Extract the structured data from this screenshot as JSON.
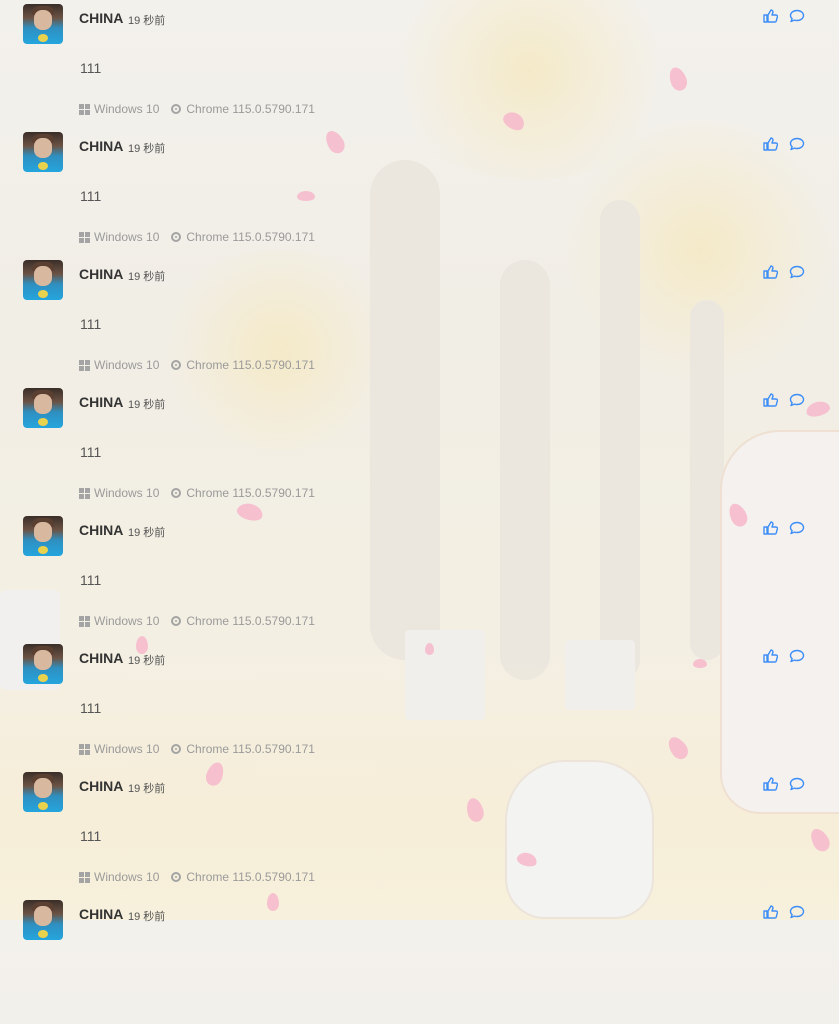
{
  "comments": [
    {
      "name": "CHINA",
      "time": "19 秒前",
      "text": "111",
      "os": "Windows 10",
      "browser": "Chrome 115.0.5790.171"
    },
    {
      "name": "CHINA",
      "time": "19 秒前",
      "text": "111",
      "os": "Windows 10",
      "browser": "Chrome 115.0.5790.171"
    },
    {
      "name": "CHINA",
      "time": "19 秒前",
      "text": "111",
      "os": "Windows 10",
      "browser": "Chrome 115.0.5790.171"
    },
    {
      "name": "CHINA",
      "time": "19 秒前",
      "text": "111",
      "os": "Windows 10",
      "browser": "Chrome 115.0.5790.171"
    },
    {
      "name": "CHINA",
      "time": "19 秒前",
      "text": "111",
      "os": "Windows 10",
      "browser": "Chrome 115.0.5790.171"
    },
    {
      "name": "CHINA",
      "time": "19 秒前",
      "text": "111",
      "os": "Windows 10",
      "browser": "Chrome 115.0.5790.171"
    },
    {
      "name": "CHINA",
      "time": "19 秒前",
      "text": "111",
      "os": "Windows 10",
      "browser": "Chrome 115.0.5790.171"
    },
    {
      "name": "CHINA",
      "time": "19 秒前",
      "text": "",
      "os": "",
      "browser": ""
    }
  ],
  "icons": {
    "like": "thumbs-up-icon",
    "reply": "comment-bubble-icon",
    "os": "windows-icon",
    "browser": "chrome-icon"
  },
  "colors": {
    "accent": "#3e8ef7",
    "name": "#333333",
    "meta": "#9a9a9a",
    "petal": "#f6b7cb"
  }
}
